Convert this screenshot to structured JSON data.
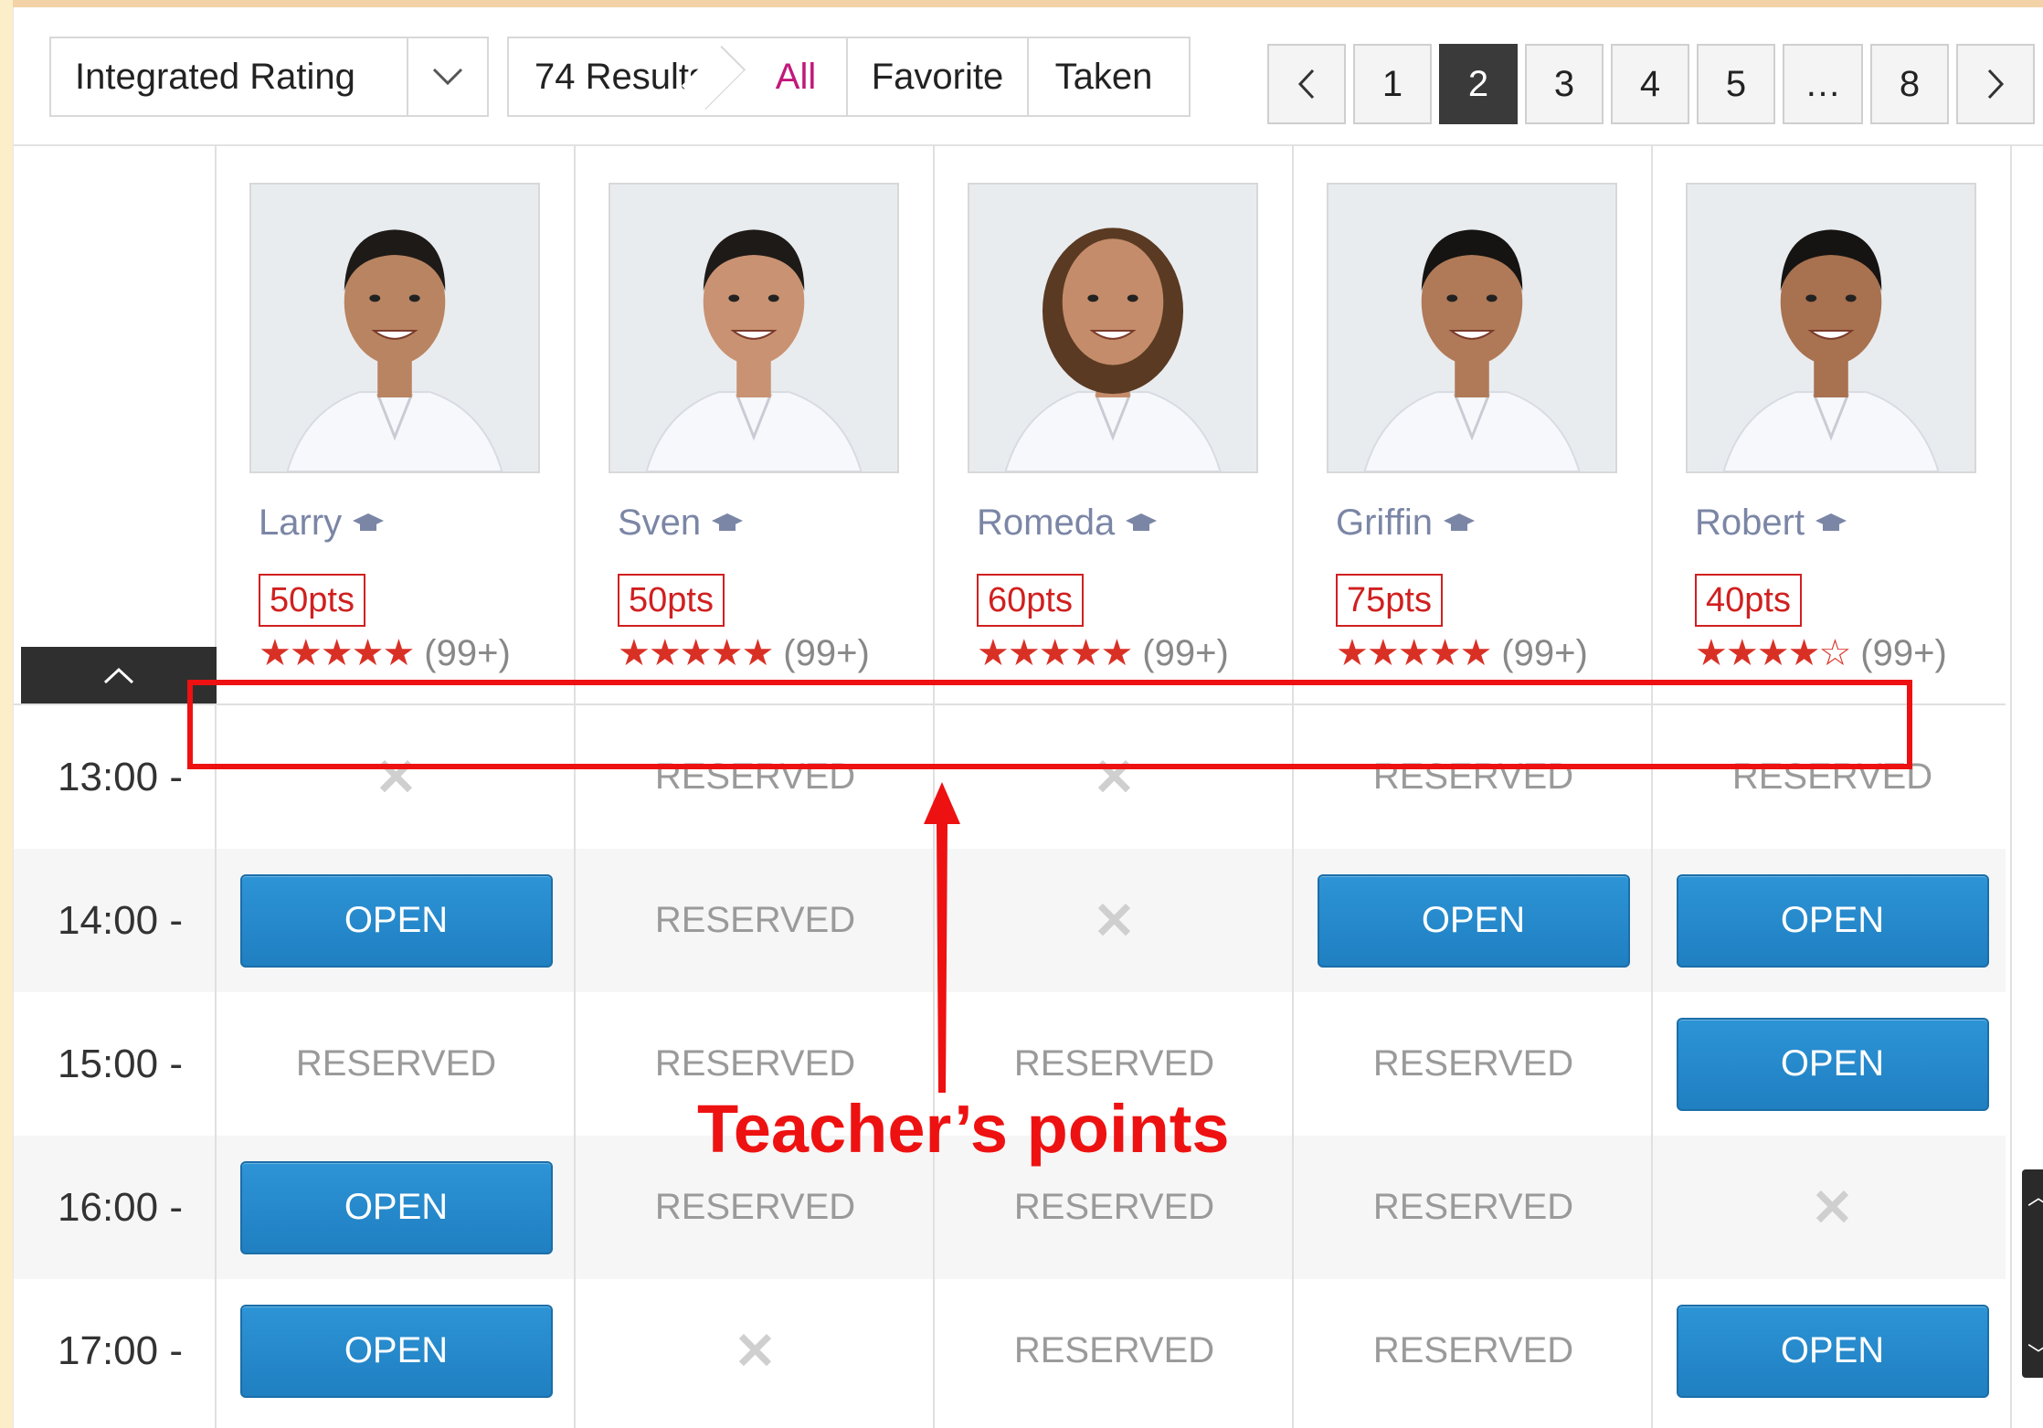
{
  "toolbar": {
    "sort_label": "Integrated Rating",
    "results_label": "74 Results",
    "filters": [
      "All",
      "Favorite",
      "Taken"
    ],
    "active_filter": "All"
  },
  "pagination": {
    "prev_icon": "chevron-left-icon",
    "next_icon": "chevron-right-icon",
    "pages": [
      "1",
      "2",
      "3",
      "4",
      "5",
      "…",
      "8"
    ],
    "current": "2"
  },
  "teachers": [
    {
      "name": "Larry",
      "points": "50pts",
      "stars": "★★★★★",
      "reviews": "(99+)"
    },
    {
      "name": "Sven",
      "points": "50pts",
      "stars": "★★★★★",
      "reviews": "(99+)"
    },
    {
      "name": "Romeda",
      "points": "60pts",
      "stars": "★★★★★",
      "reviews": "(99+)"
    },
    {
      "name": "Griffin",
      "points": "75pts",
      "stars": "★★★★★",
      "reviews": "(99+)"
    },
    {
      "name": "Robert",
      "points": "40pts",
      "stars": "★★★★☆",
      "reviews": "(99+)"
    }
  ],
  "labels": {
    "reserved": "RESERVED",
    "open": "OPEN",
    "unavailable": "✕"
  },
  "schedule": [
    {
      "time": "13:00 -",
      "slots": [
        "x",
        "reserved",
        "x",
        "reserved",
        "reserved"
      ]
    },
    {
      "time": "14:00 -",
      "slots": [
        "open",
        "reserved",
        "x",
        "open",
        "open"
      ]
    },
    {
      "time": "15:00 -",
      "slots": [
        "reserved",
        "reserved",
        "reserved",
        "reserved",
        "open"
      ]
    },
    {
      "time": "16:00 -",
      "slots": [
        "open",
        "reserved",
        "reserved",
        "reserved",
        "x"
      ]
    },
    {
      "time": "17:00 -",
      "slots": [
        "open",
        "x",
        "reserved",
        "reserved",
        "open"
      ]
    }
  ],
  "annotation": {
    "callout": "Teacher’s points",
    "color": "#ee1111"
  },
  "colors": {
    "accent_blue": "#1f7fc1",
    "filter_active": "#c2187a",
    "star": "#d93025",
    "points_red": "#d02020"
  }
}
